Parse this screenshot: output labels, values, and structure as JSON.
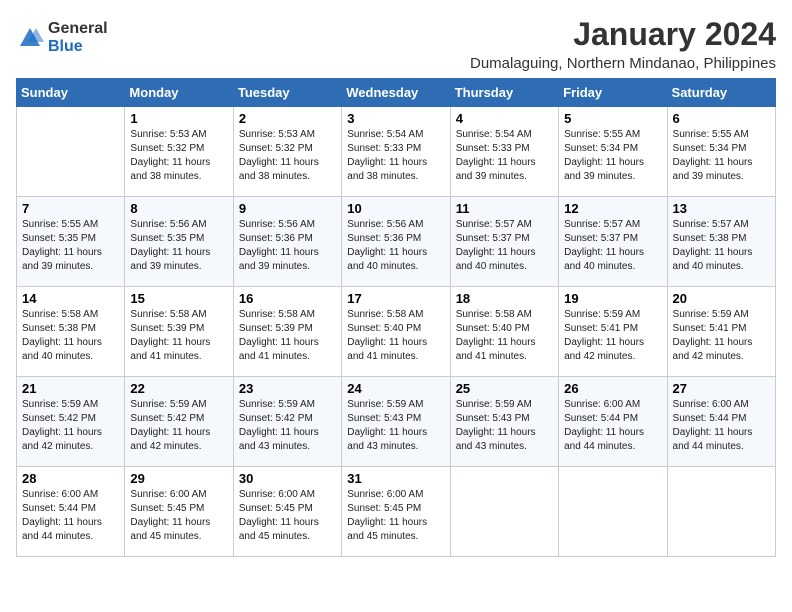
{
  "logo": {
    "general": "General",
    "blue": "Blue"
  },
  "header": {
    "month": "January 2024",
    "location": "Dumalaguing, Northern Mindanao, Philippines"
  },
  "weekdays": [
    "Sunday",
    "Monday",
    "Tuesday",
    "Wednesday",
    "Thursday",
    "Friday",
    "Saturday"
  ],
  "weeks": [
    [
      {
        "day": "",
        "info": ""
      },
      {
        "day": "1",
        "info": "Sunrise: 5:53 AM\nSunset: 5:32 PM\nDaylight: 11 hours\nand 38 minutes."
      },
      {
        "day": "2",
        "info": "Sunrise: 5:53 AM\nSunset: 5:32 PM\nDaylight: 11 hours\nand 38 minutes."
      },
      {
        "day": "3",
        "info": "Sunrise: 5:54 AM\nSunset: 5:33 PM\nDaylight: 11 hours\nand 38 minutes."
      },
      {
        "day": "4",
        "info": "Sunrise: 5:54 AM\nSunset: 5:33 PM\nDaylight: 11 hours\nand 39 minutes."
      },
      {
        "day": "5",
        "info": "Sunrise: 5:55 AM\nSunset: 5:34 PM\nDaylight: 11 hours\nand 39 minutes."
      },
      {
        "day": "6",
        "info": "Sunrise: 5:55 AM\nSunset: 5:34 PM\nDaylight: 11 hours\nand 39 minutes."
      }
    ],
    [
      {
        "day": "7",
        "info": "Sunrise: 5:55 AM\nSunset: 5:35 PM\nDaylight: 11 hours\nand 39 minutes."
      },
      {
        "day": "8",
        "info": "Sunrise: 5:56 AM\nSunset: 5:35 PM\nDaylight: 11 hours\nand 39 minutes."
      },
      {
        "day": "9",
        "info": "Sunrise: 5:56 AM\nSunset: 5:36 PM\nDaylight: 11 hours\nand 39 minutes."
      },
      {
        "day": "10",
        "info": "Sunrise: 5:56 AM\nSunset: 5:36 PM\nDaylight: 11 hours\nand 40 minutes."
      },
      {
        "day": "11",
        "info": "Sunrise: 5:57 AM\nSunset: 5:37 PM\nDaylight: 11 hours\nand 40 minutes."
      },
      {
        "day": "12",
        "info": "Sunrise: 5:57 AM\nSunset: 5:37 PM\nDaylight: 11 hours\nand 40 minutes."
      },
      {
        "day": "13",
        "info": "Sunrise: 5:57 AM\nSunset: 5:38 PM\nDaylight: 11 hours\nand 40 minutes."
      }
    ],
    [
      {
        "day": "14",
        "info": "Sunrise: 5:58 AM\nSunset: 5:38 PM\nDaylight: 11 hours\nand 40 minutes."
      },
      {
        "day": "15",
        "info": "Sunrise: 5:58 AM\nSunset: 5:39 PM\nDaylight: 11 hours\nand 41 minutes."
      },
      {
        "day": "16",
        "info": "Sunrise: 5:58 AM\nSunset: 5:39 PM\nDaylight: 11 hours\nand 41 minutes."
      },
      {
        "day": "17",
        "info": "Sunrise: 5:58 AM\nSunset: 5:40 PM\nDaylight: 11 hours\nand 41 minutes."
      },
      {
        "day": "18",
        "info": "Sunrise: 5:58 AM\nSunset: 5:40 PM\nDaylight: 11 hours\nand 41 minutes."
      },
      {
        "day": "19",
        "info": "Sunrise: 5:59 AM\nSunset: 5:41 PM\nDaylight: 11 hours\nand 42 minutes."
      },
      {
        "day": "20",
        "info": "Sunrise: 5:59 AM\nSunset: 5:41 PM\nDaylight: 11 hours\nand 42 minutes."
      }
    ],
    [
      {
        "day": "21",
        "info": "Sunrise: 5:59 AM\nSunset: 5:42 PM\nDaylight: 11 hours\nand 42 minutes."
      },
      {
        "day": "22",
        "info": "Sunrise: 5:59 AM\nSunset: 5:42 PM\nDaylight: 11 hours\nand 42 minutes."
      },
      {
        "day": "23",
        "info": "Sunrise: 5:59 AM\nSunset: 5:42 PM\nDaylight: 11 hours\nand 43 minutes."
      },
      {
        "day": "24",
        "info": "Sunrise: 5:59 AM\nSunset: 5:43 PM\nDaylight: 11 hours\nand 43 minutes."
      },
      {
        "day": "25",
        "info": "Sunrise: 5:59 AM\nSunset: 5:43 PM\nDaylight: 11 hours\nand 43 minutes."
      },
      {
        "day": "26",
        "info": "Sunrise: 6:00 AM\nSunset: 5:44 PM\nDaylight: 11 hours\nand 44 minutes."
      },
      {
        "day": "27",
        "info": "Sunrise: 6:00 AM\nSunset: 5:44 PM\nDaylight: 11 hours\nand 44 minutes."
      }
    ],
    [
      {
        "day": "28",
        "info": "Sunrise: 6:00 AM\nSunset: 5:44 PM\nDaylight: 11 hours\nand 44 minutes."
      },
      {
        "day": "29",
        "info": "Sunrise: 6:00 AM\nSunset: 5:45 PM\nDaylight: 11 hours\nand 45 minutes."
      },
      {
        "day": "30",
        "info": "Sunrise: 6:00 AM\nSunset: 5:45 PM\nDaylight: 11 hours\nand 45 minutes."
      },
      {
        "day": "31",
        "info": "Sunrise: 6:00 AM\nSunset: 5:45 PM\nDaylight: 11 hours\nand 45 minutes."
      },
      {
        "day": "",
        "info": ""
      },
      {
        "day": "",
        "info": ""
      },
      {
        "day": "",
        "info": ""
      }
    ]
  ]
}
